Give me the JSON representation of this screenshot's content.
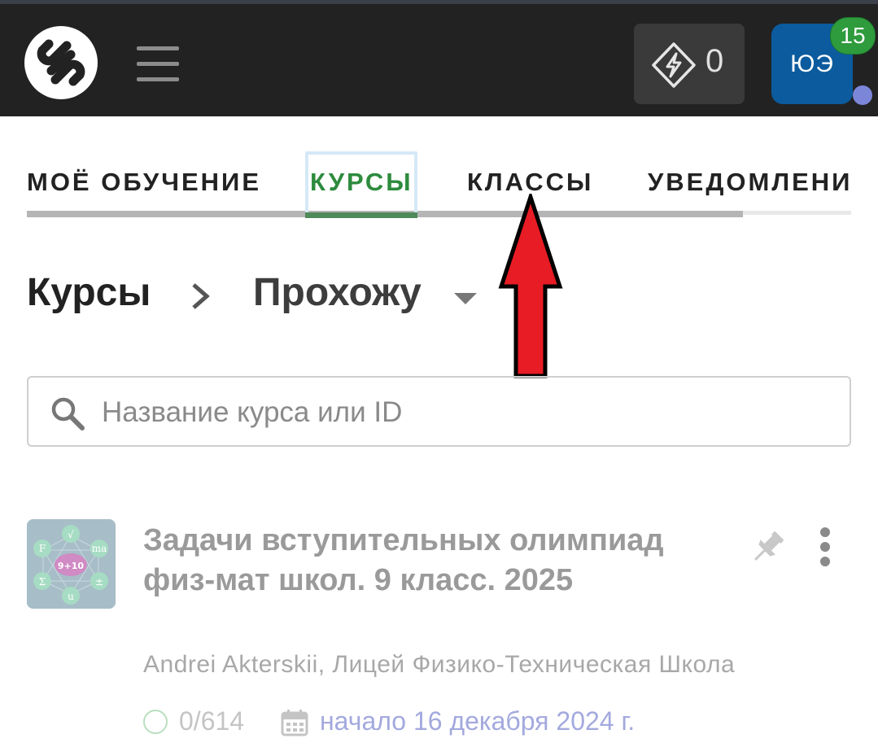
{
  "header": {
    "energy_count": "0",
    "avatar_initials": "ЮЭ",
    "notifications_count": "15"
  },
  "tabs": [
    {
      "label": "МОЁ ОБУЧЕНИЕ",
      "active": false
    },
    {
      "label": "КУРСЫ",
      "active": true
    },
    {
      "label": "КЛАССЫ",
      "active": false
    },
    {
      "label": "УВЕДОМЛЕНИ",
      "active": false
    }
  ],
  "breadcrumb": {
    "root": "Курсы",
    "current": "Прохожу"
  },
  "search": {
    "placeholder": "Название курса или ID",
    "value": ""
  },
  "courses": [
    {
      "title": "Задачи вступительных олимпиад физ-мат школ. 9 класс. 2025",
      "authors": "Andrei Akterskii, Лицей Физико-Техническая Школа",
      "progress": "0/614",
      "start": "начало 16 декабря 2024 г.",
      "thumb_center": "9+10",
      "thumb_symbols": [
        "√",
        "ma",
        "±",
        "u",
        "Σ",
        "F"
      ]
    }
  ],
  "colors": {
    "topbar": "#222222",
    "active_tab": "#2e8b3e",
    "avatar_bg": "#0b5b9e",
    "badge": "#2e9b3d",
    "annotation_arrow": "#e81c24"
  }
}
